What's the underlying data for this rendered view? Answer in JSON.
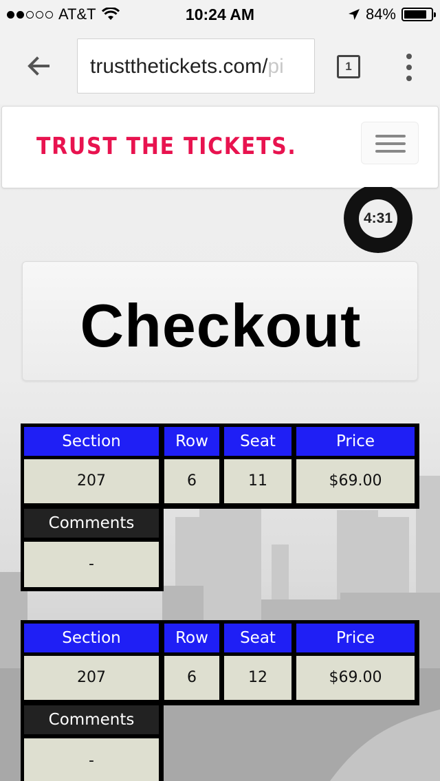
{
  "status_bar": {
    "carrier": "AT&T",
    "time": "10:24 AM",
    "battery": "84%",
    "battery_level": 0.84
  },
  "browser": {
    "url_main": "trustthetickets.com/",
    "url_faded": "pi",
    "tab_count": "1"
  },
  "site": {
    "logo": "TRUST THE TICKETS.",
    "brand_color": "#e8134f"
  },
  "timer": {
    "remaining": "4:31"
  },
  "page": {
    "title": "Checkout"
  },
  "table_headers": {
    "section": "Section",
    "row": "Row",
    "seat": "Seat",
    "price": "Price",
    "comments": "Comments"
  },
  "tickets": [
    {
      "section": "207",
      "row": "6",
      "seat": "11",
      "price": "$69.00",
      "comments": "-"
    },
    {
      "section": "207",
      "row": "6",
      "seat": "12",
      "price": "$69.00",
      "comments": "-"
    }
  ],
  "colors": {
    "header_blue": "#1f1ff5",
    "cell_bg": "#dedfd0",
    "comments_header": "#222222"
  }
}
